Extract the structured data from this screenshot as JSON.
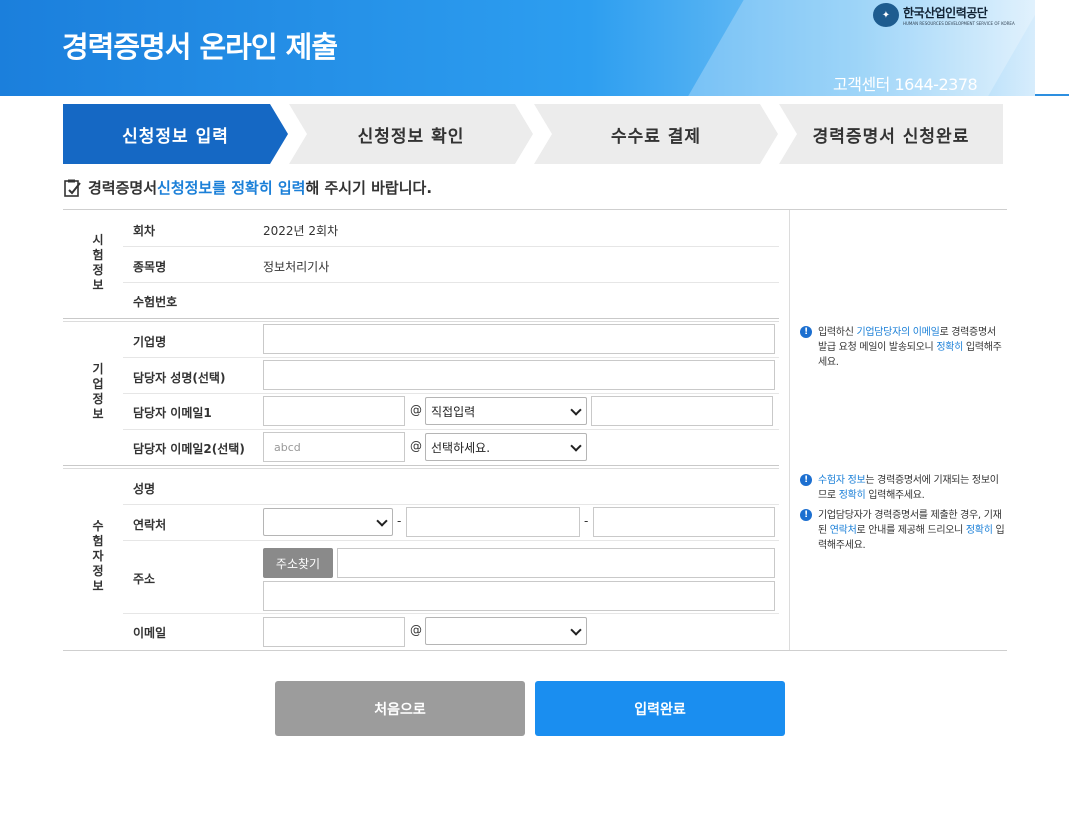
{
  "header": {
    "title": "경력증명서 온라인 제출",
    "callcenter": "고객센터 1644-2378",
    "logo_kr": "한국산업인력공단",
    "logo_en": "HUMAN RESOURCES DEVELOPMENT SERVICE OF KOREA"
  },
  "steps": [
    "신청정보 입력",
    "신청정보 확인",
    "수수료 결제",
    "경력증명서 신청완료"
  ],
  "notice": {
    "pre": "경력증명서 ",
    "highlight": "신청정보를 정확히 입력",
    "post": "해 주시기 바랍니다."
  },
  "sections": {
    "exam": "시험정보",
    "company": "기업정보",
    "examinee": "수험자정보"
  },
  "exam": {
    "round_label": "회차",
    "round_value": "2022년 2회차",
    "subject_label": "종목명",
    "subject_value": "정보처리기사",
    "number_label": "수험번호"
  },
  "company": {
    "name_label": "기업명",
    "manager_label": "담당자 성명(선택)",
    "email1_label": "담당자 이메일1",
    "email1_domain_select": "직접입력",
    "email2_label": "담당자 이메일2(선택)",
    "email2_placeholder": "abcd",
    "email2_domain_select": "선택하세요."
  },
  "examinee": {
    "name_label": "성명",
    "phone_label": "연락처",
    "address_label": "주소",
    "address_button": "주소찾기",
    "email_label": "이메일"
  },
  "at_symbol": "@",
  "dash": "-",
  "info": {
    "company": {
      "pre": "입력하신 ",
      "hl": "기업담당자의 이메일",
      "post1": "로 경력증명서 발급 요청 메일이 발송되오니 ",
      "hl2": "정확히",
      "post2": " 입력해주세요."
    },
    "examinee1": {
      "hl": "수험자 정보",
      "post1": "는 경력증명서에 기재되는 정보이므로 ",
      "hl2": "정확히",
      "post2": " 입력해주세요."
    },
    "examinee2": {
      "pre": "기업담당자가 경력증명서를 제출한 경우, 기재된 ",
      "hl": "연락처",
      "post1": "로 안내를 제공해 드리오니 ",
      "hl2": "정확히",
      "post2": " 입력해주세요."
    }
  },
  "buttons": {
    "reset": "처음으로",
    "submit": "입력완료"
  },
  "colors": {
    "primary": "#1568c4",
    "accent": "#1a8ef0",
    "highlight": "#1c80d8"
  }
}
